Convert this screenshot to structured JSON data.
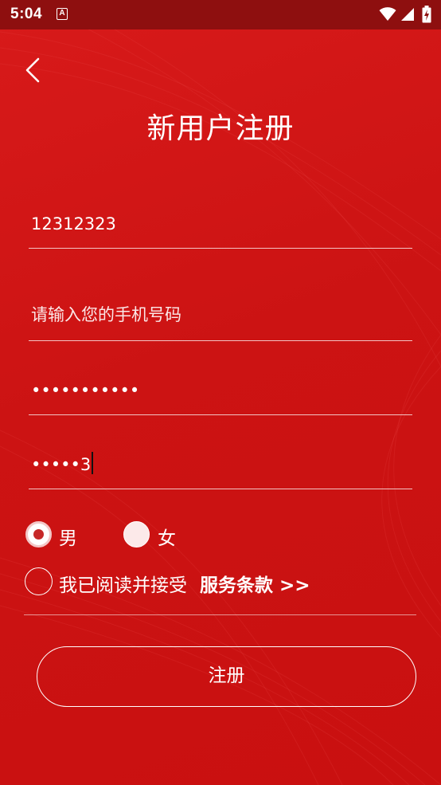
{
  "status_bar": {
    "time": "5:04",
    "notification_icon": "A"
  },
  "header": {
    "title": "新用户注册",
    "back_icon": "chevron-left-icon"
  },
  "form": {
    "username": "12312323",
    "phone_placeholder": "请输入您的手机号码",
    "password_masked": "•••••••••••",
    "confirm_password_masked": "•••••3"
  },
  "gender": {
    "male_label": "男",
    "female_label": "女",
    "selected": "男"
  },
  "agreement": {
    "text": "我已阅读并接受",
    "link_label": "服务条款 >>"
  },
  "register_button": {
    "label": "注册"
  },
  "colors": {
    "background": "#cf1515",
    "status_bar": "#8e0f0f",
    "text": "#ffffff"
  }
}
